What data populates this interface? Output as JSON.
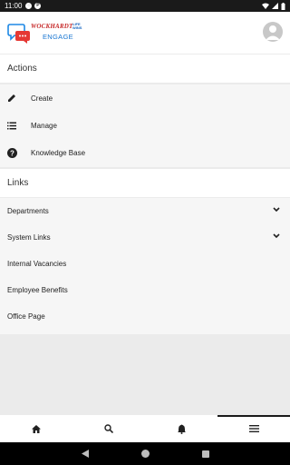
{
  "status_bar": {
    "time": "11:00"
  },
  "header": {
    "logo": {
      "brand": "WOCKHARDT",
      "tagline_1": "LIFE",
      "tagline_2": "WINS",
      "product": "ENGAGE"
    },
    "avatar": "avatar-icon"
  },
  "actions": {
    "title": "Actions",
    "items": [
      {
        "label": "Create",
        "icon": "pencil-icon"
      },
      {
        "label": "Manage",
        "icon": "list-icon"
      },
      {
        "label": "Knowledge Base",
        "icon": "help-circle-icon"
      }
    ]
  },
  "links": {
    "title": "Links",
    "items": [
      {
        "label": "Departments",
        "expandable": true
      },
      {
        "label": "System Links",
        "expandable": true
      },
      {
        "label": "Internal Vacancies",
        "expandable": false
      },
      {
        "label": "Employee Benefits",
        "expandable": false
      },
      {
        "label": "Office Page",
        "expandable": false
      }
    ]
  },
  "bottom_nav": [
    {
      "icon": "home-icon"
    },
    {
      "icon": "search-icon"
    },
    {
      "icon": "bell-icon"
    },
    {
      "icon": "menu-icon",
      "active": true
    }
  ]
}
